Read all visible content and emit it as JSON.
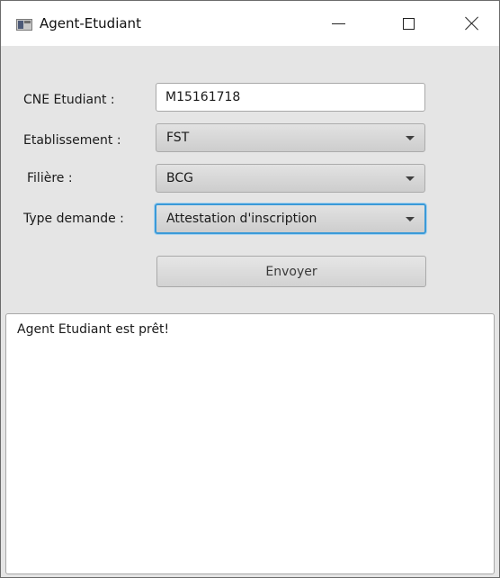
{
  "window": {
    "title": "Agent-Etudiant",
    "icon": "app-window-icon"
  },
  "form": {
    "cne": {
      "label": "CNE Etudiant :",
      "value": "M15161718"
    },
    "etablissement": {
      "label": "Etablissement :",
      "selected": "FST"
    },
    "filiere": {
      "label": "Filière :",
      "selected": "BCG"
    },
    "type_demande": {
      "label": "Type demande :",
      "selected": "Attestation d'inscription"
    },
    "submit_label": "Envoyer"
  },
  "log": {
    "text": "Agent Etudiant est prêt!"
  },
  "colors": {
    "background": "#e5e5e5",
    "focus_border": "#3b9ad8"
  }
}
